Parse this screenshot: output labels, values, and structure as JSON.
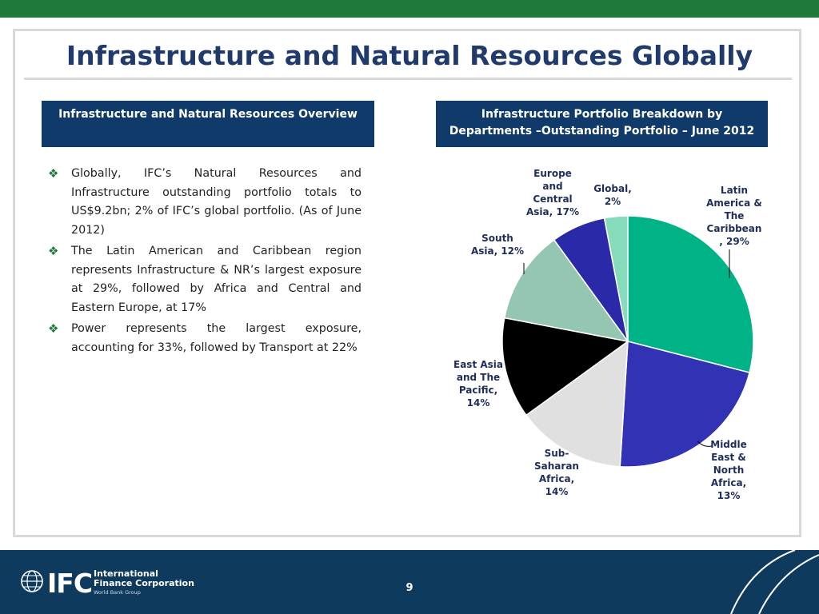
{
  "title": "Infrastructure and Natural Resources  Globally",
  "left_box": {
    "label": "Infrastructure and Natural Resources Overview"
  },
  "right_box": {
    "line1": "Infrastructure Portfolio Breakdown by",
    "line2": "Departments –Outstanding Portfolio – June 2012"
  },
  "bullets": [
    "Globally, IFC’s Natural Resources and Infrastructure outstanding portfolio totals to US$9.2bn; 2% of IFC’s global portfolio. (As of June 2012)",
    "The Latin American and Caribbean region represents Infrastructure & NR’s largest exposure at 29%, followed by Africa and Central and Eastern Europe, at 17%",
    "Power represents the largest exposure, accounting for 33%,  followed by Transport at 22%"
  ],
  "footer": {
    "logo_letters": "IFC",
    "logo_line1": "International",
    "logo_line2": "Finance Corporation",
    "logo_line3": "World Bank Group",
    "page_number": "9"
  },
  "colors": {
    "green_bar": "#1f7a3a",
    "title": "#1f3a6b",
    "box": "#0f3a69",
    "footer": "#0e3a5e"
  },
  "chart_data": {
    "type": "pie",
    "slices": [
      {
        "label": [
          "Latin",
          "America &",
          "The",
          "Caribbean",
          ", 29%"
        ],
        "value": 29,
        "color": "#00b386"
      },
      {
        "label": [
          "Middle",
          "East &",
          "North",
          "Africa,",
          "13%"
        ],
        "value": 22,
        "color": "#3232b4"
      },
      {
        "label": [
          "Sub-",
          "Saharan",
          "Africa,",
          "14%"
        ],
        "value": 14,
        "color": "#e0e0e0"
      },
      {
        "label": [
          "East Asia",
          "and The",
          "Pacific,",
          "14%"
        ],
        "value": 13,
        "color": "#000000"
      },
      {
        "label": [
          "South",
          "Asia, 12%"
        ],
        "value": 12,
        "color": "#94c6b2"
      },
      {
        "label": [
          "Europe",
          "and",
          "Central",
          "Asia, 17%"
        ],
        "value": 7,
        "color": "#2a2aa8"
      },
      {
        "label": [
          "Global,",
          "2%"
        ],
        "value": 3,
        "color": "#86dbbb"
      }
    ]
  }
}
